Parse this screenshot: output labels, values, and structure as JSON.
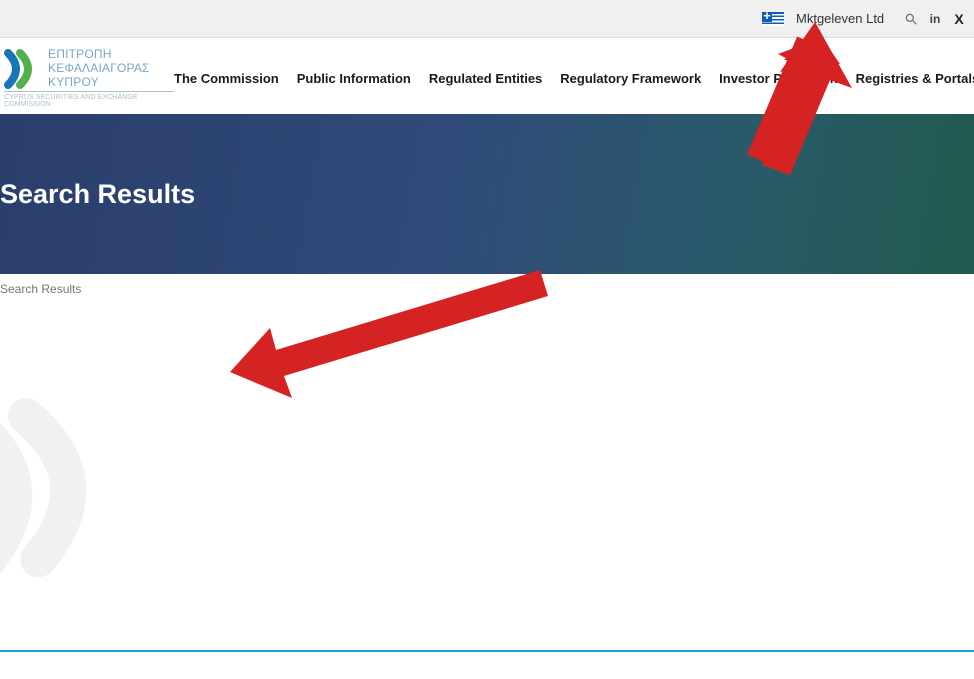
{
  "topbar": {
    "search_value": "Mktgeleven Ltd",
    "lang_flag": "greece-flag-icon",
    "search_icon": "search-icon",
    "linkedin_icon": "linkedin-icon",
    "x_icon": "x-social-icon"
  },
  "logo": {
    "line1": "ΕΠΙΤΡΟΠΗ",
    "line2": "ΚΕΦΑΛΑΙΑΓΟΡΑΣ",
    "line3": "ΚΥΠΡΟΥ",
    "sub": "CYPRUS SECURITIES AND EXCHANGE COMMISSION"
  },
  "nav": {
    "items": [
      "The Commission",
      "Public Information",
      "Regulated Entities",
      "Regulatory Framework",
      "Investor Protection",
      "Registries & Portals"
    ]
  },
  "hero": {
    "title": "Search Results"
  },
  "breadcrumb": {
    "text": "Search Results"
  },
  "colors": {
    "arrow": "#d52323",
    "hero_start": "#2a3e6b",
    "hero_end": "#1f5a4d",
    "accent": "#1da0d8",
    "logo_text": "#7aa6c2"
  }
}
